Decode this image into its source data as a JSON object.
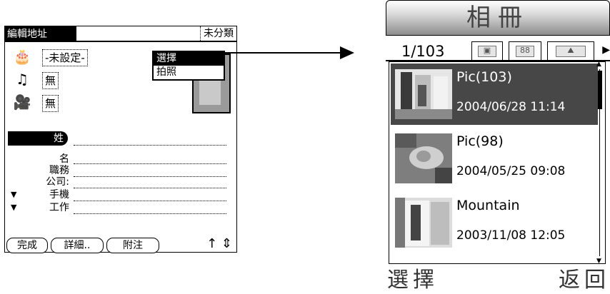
{
  "left_screen": {
    "title": "編輯地址",
    "category": "未分類",
    "rows": [
      {
        "icon": "birthday-cake-icon",
        "value": "-未設定-"
      },
      {
        "icon": "ringtone-icon",
        "value": "無"
      },
      {
        "icon": "video-icon",
        "value": "無"
      }
    ],
    "popup": {
      "items": [
        "選擇",
        "拍照"
      ],
      "selected": 0
    },
    "surname_label": "姓",
    "fields": [
      "名",
      "職務",
      "公司:",
      "手機",
      "工作"
    ],
    "buttons": [
      "完成",
      "詳細..",
      "附注"
    ],
    "footer_icons": "↑ ⇕"
  },
  "arrow": {
    "direction": "right"
  },
  "right_screen": {
    "title": "相冊",
    "count": "1/103",
    "tabs": [
      {
        "icon": "album-icon",
        "glyph": "▣"
      },
      {
        "icon": "people-icon",
        "glyph": "88"
      },
      {
        "icon": "mountain-icon",
        "glyph": "⛰"
      }
    ],
    "items": [
      {
        "name": "Pic(103)",
        "date": "2004/06/28 11:14",
        "selected": true
      },
      {
        "name": "Pic(98)",
        "date": "2004/05/25 09:08",
        "selected": false
      },
      {
        "name": "Mountain",
        "date": "2003/11/08 12:05",
        "selected": false
      }
    ],
    "softkeys": {
      "left": "選擇",
      "right": "返回"
    }
  }
}
